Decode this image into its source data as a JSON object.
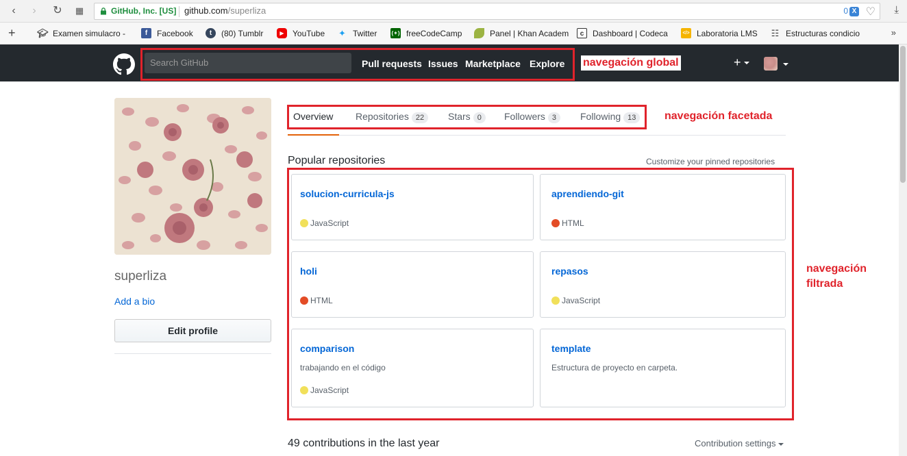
{
  "browser": {
    "secure_label": "GitHub, Inc. [US]",
    "url_host": "github.com",
    "url_path": "/superliza",
    "ext_count": "0",
    "ext_badge": "X",
    "bookmarks": [
      {
        "label": "Examen simulacro -",
        "icon": "graduation-cap-icon"
      },
      {
        "label": "Facebook",
        "icon": "facebook-icon"
      },
      {
        "label": "(80) Tumblr",
        "icon": "tumblr-icon"
      },
      {
        "label": "YouTube",
        "icon": "youtube-icon"
      },
      {
        "label": "Twitter",
        "icon": "twitter-icon"
      },
      {
        "label": "freeCodeCamp",
        "icon": "freecodecamp-icon"
      },
      {
        "label": "Panel | Khan Academ",
        "icon": "khan-academy-icon"
      },
      {
        "label": "Dashboard | Codeca",
        "icon": "codecademy-icon"
      },
      {
        "label": "Laboratoria LMS",
        "icon": "laboratoria-icon"
      },
      {
        "label": "Estructuras condicio",
        "icon": "book-icon"
      }
    ],
    "more_label": "»"
  },
  "header": {
    "search_placeholder": "Search GitHub",
    "nav": [
      "Pull requests",
      "Issues",
      "Marketplace",
      "Explore"
    ],
    "plus_label": "+"
  },
  "annotations": {
    "global": "navegación global",
    "faceted": "navegación facetada",
    "filtered": "navegación\nfiltrada"
  },
  "profile": {
    "username": "superliza",
    "add_bio": "Add a bio",
    "edit_profile": "Edit profile"
  },
  "tabs": [
    {
      "label": "Overview",
      "count": null
    },
    {
      "label": "Repositories",
      "count": "22"
    },
    {
      "label": "Stars",
      "count": "0"
    },
    {
      "label": "Followers",
      "count": "3"
    },
    {
      "label": "Following",
      "count": "13"
    }
  ],
  "popular": {
    "title": "Popular repositories",
    "customize": "Customize your pinned repositories",
    "repos": [
      {
        "name": "solucion-curricula-js",
        "description": "",
        "language": "JavaScript",
        "lang_color": "#f1e05a"
      },
      {
        "name": "aprendiendo-git",
        "description": "",
        "language": "HTML",
        "lang_color": "#e34c26"
      },
      {
        "name": "holi",
        "description": "",
        "language": "HTML",
        "lang_color": "#e34c26"
      },
      {
        "name": "repasos",
        "description": "",
        "language": "JavaScript",
        "lang_color": "#f1e05a"
      },
      {
        "name": "comparison",
        "description": "trabajando en el código",
        "language": "JavaScript",
        "lang_color": "#f1e05a"
      },
      {
        "name": "template",
        "description": "Estructura de proyecto en carpeta.",
        "language": "",
        "lang_color": ""
      }
    ]
  },
  "contributions": {
    "summary": "49 contributions in the last year",
    "settings": "Contribution settings"
  }
}
